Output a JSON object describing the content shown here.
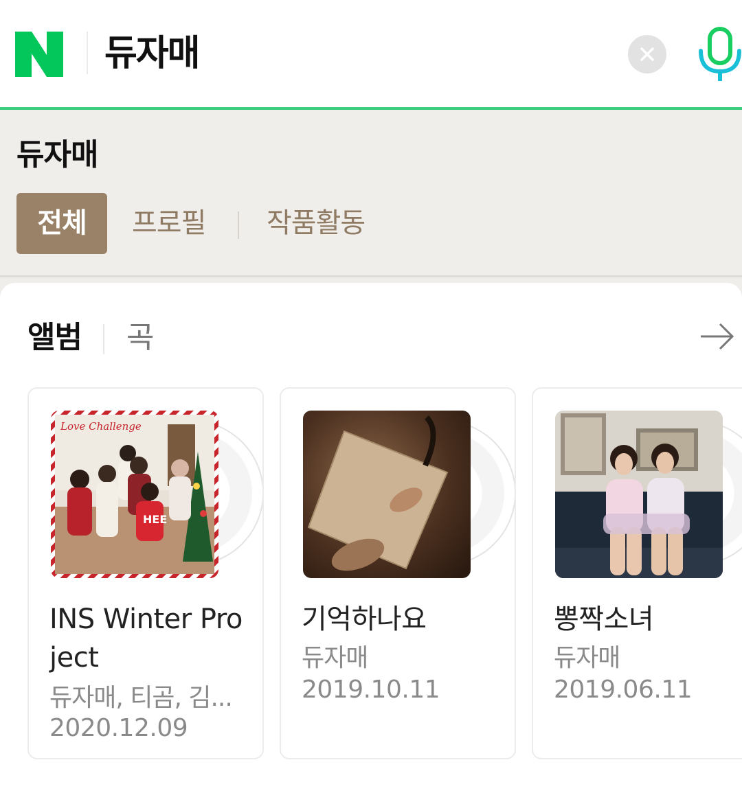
{
  "search": {
    "query": "듀자매",
    "logo_letter": "N",
    "icons": {
      "clear": "close-icon",
      "voice": "microphone-icon"
    },
    "colors": {
      "brand": "#03c75a",
      "accent_line": "#3dcd7f",
      "mic": "#19ce60"
    }
  },
  "header": {
    "title": "듀자매",
    "tabs": [
      {
        "label": "전체",
        "active": true
      },
      {
        "label": "프로필",
        "active": false
      },
      {
        "label": "작품활동",
        "active": false
      }
    ],
    "colors": {
      "active_tab_bg": "#9a8268",
      "tab_text": "#8f7a63"
    }
  },
  "section": {
    "tabs": [
      {
        "label": "앨범",
        "active": true
      },
      {
        "label": "곡",
        "active": false
      }
    ],
    "more_icon": "arrow-right-icon"
  },
  "albums": [
    {
      "title": "INS Winter Project",
      "artist": "듀자매, 티곰, 김...",
      "date": "2020.12.09",
      "cover_text": "Love Challenge"
    },
    {
      "title": "기억하나요",
      "artist": "듀자매",
      "date": "2019.10.11"
    },
    {
      "title": "뽕짝소녀",
      "artist": "듀자매",
      "date": "2019.06.11"
    }
  ]
}
